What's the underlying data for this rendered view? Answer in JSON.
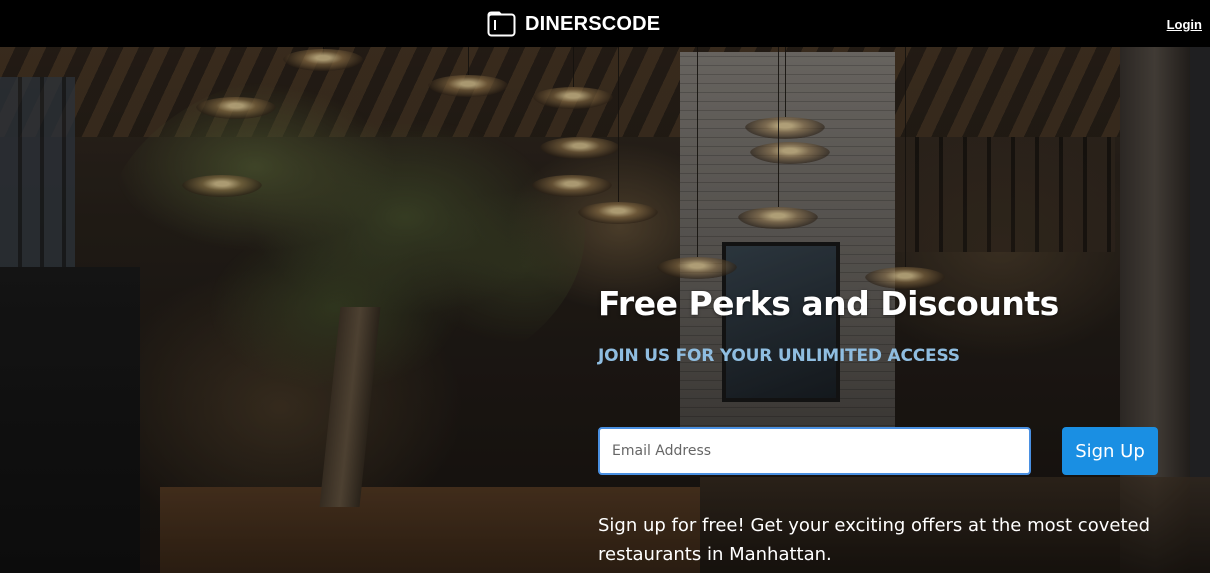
{
  "header": {
    "brand_name": "DINERSCODE",
    "brand_icon": "book-icon",
    "login_label": "Login"
  },
  "hero": {
    "title": "Free Perks and Discounts",
    "subtitle": "JOIN US FOR YOUR UNLIMITED ACCESS",
    "email_placeholder": "Email Address",
    "email_value": "",
    "signup_label": "Sign Up",
    "description": "Sign up for free! Get your exciting offers at the most coveted restaurants in Manhattan."
  },
  "colors": {
    "topbar": "#000000",
    "subtitle": "#8fbde0",
    "button": "#1a8fe3",
    "input_border": "#4a90e2"
  }
}
